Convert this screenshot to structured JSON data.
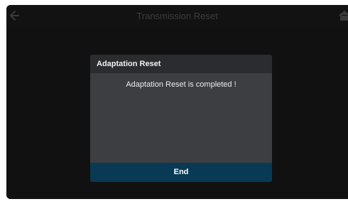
{
  "topbar": {
    "title": "Transmission Reset",
    "back_icon": "back-arrow-icon",
    "home_icon": "home-icon"
  },
  "dialog": {
    "title": "Adaptation Reset",
    "message": "Adaptation Reset is completed !",
    "end_label": "End"
  },
  "colors": {
    "screen_background": "#0b0b0b",
    "dialog_background": "#3c3e41",
    "dialog_header": "#2a2c2f",
    "end_button": "#083a55"
  }
}
